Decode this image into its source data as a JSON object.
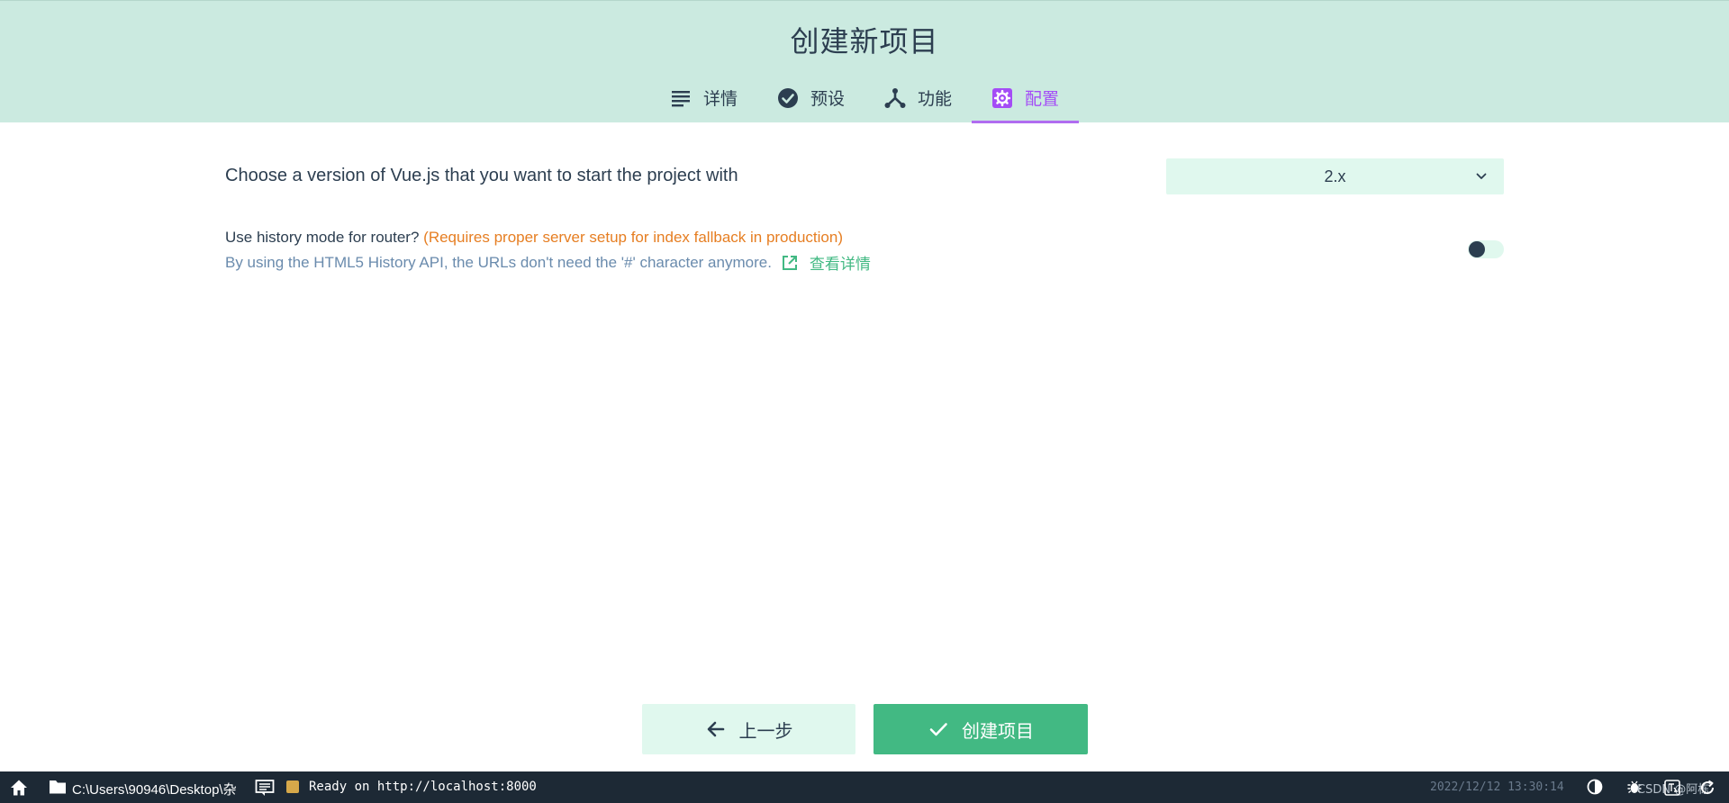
{
  "header": {
    "title": "创建新项目",
    "tabs": [
      {
        "label": "详情",
        "icon": "list-icon",
        "active": false
      },
      {
        "label": "预设",
        "icon": "check-circle-icon",
        "active": false
      },
      {
        "label": "功能",
        "icon": "fork-icon",
        "active": false
      },
      {
        "label": "配置",
        "icon": "gear-icon",
        "active": true
      }
    ]
  },
  "config": {
    "version_label": "Choose a version of Vue.js that you want to start the project with",
    "version_value": "2.x",
    "history_title": "Use history mode for router?",
    "history_warning": "(Requires proper server setup for index fallback in production)",
    "history_desc": "By using the HTML5 History API, the URLs don't need the '#' character anymore.",
    "history_link": "查看详情",
    "history_enabled": false
  },
  "actions": {
    "prev_label": "上一步",
    "create_label": "创建项目"
  },
  "statusbar": {
    "path": "C:\\Users\\90946\\Desktop\\杂",
    "status": "Ready on http://localhost:8000",
    "datetime": "2022/12/12 13:30:14",
    "watermark": "CSDN @阿栋"
  },
  "colors": {
    "header_bg": "#cbeae0",
    "accent_green": "#42b983",
    "accent_purple": "#a44cf6",
    "warning": "#e67e22",
    "statusbar_bg": "#1d2935"
  }
}
